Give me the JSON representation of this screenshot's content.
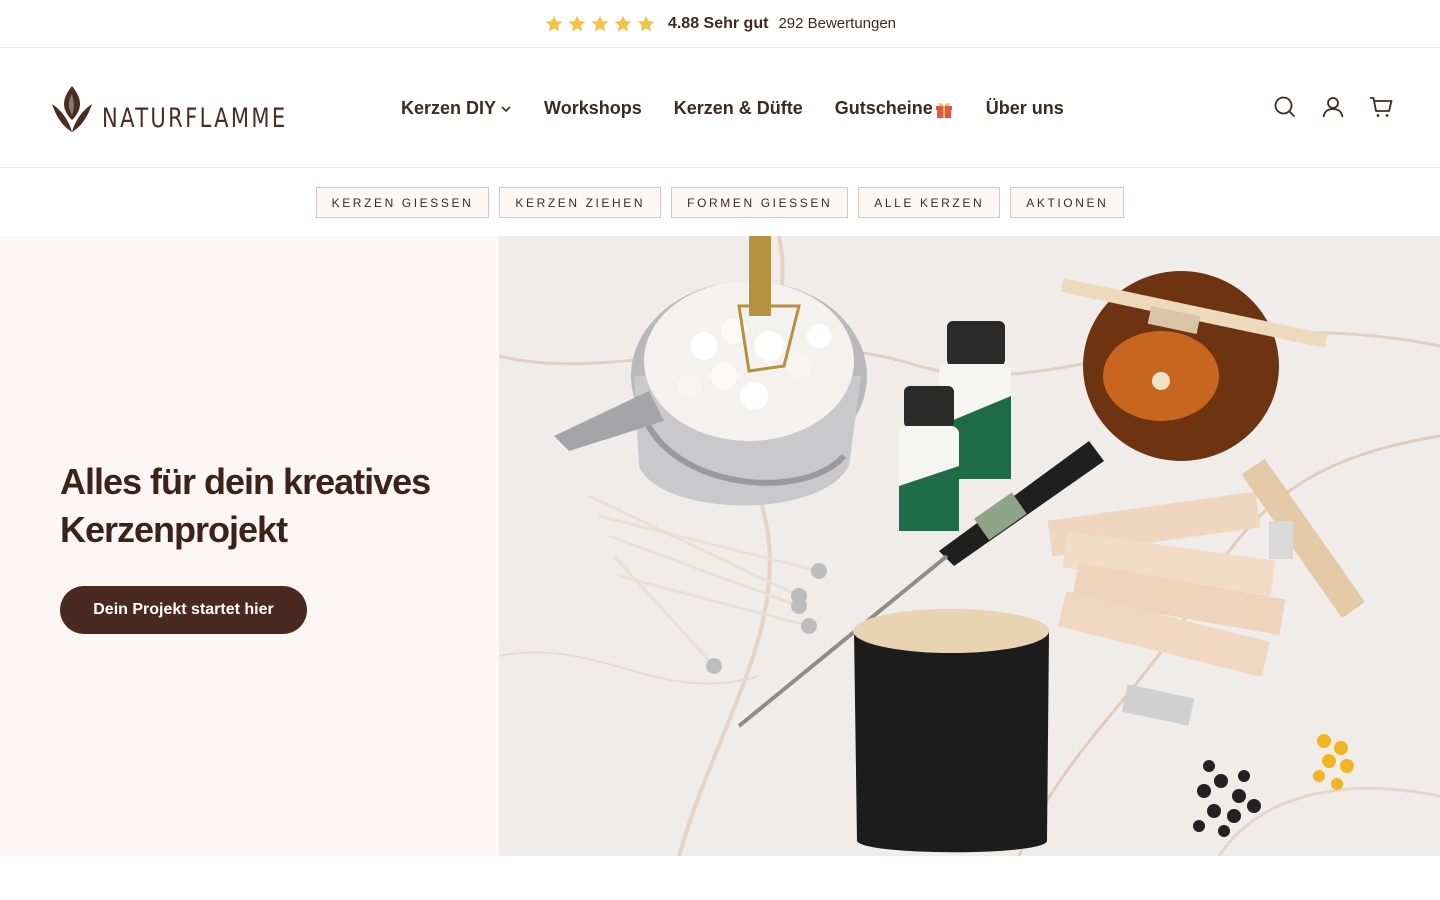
{
  "rating": {
    "stars": 5,
    "score_label": "4.88 Sehr gut",
    "count_label": "292 Bewertungen",
    "star_color": "#f5c343"
  },
  "header": {
    "logo_text": "NATURFLAMME",
    "nav": [
      {
        "label": "Kerzen DIY",
        "has_dropdown": true
      },
      {
        "label": "Workshops"
      },
      {
        "label": "Kerzen & Düfte"
      },
      {
        "label": "Gutscheine",
        "icon": "gift-icon"
      },
      {
        "label": "Über uns"
      }
    ],
    "icons": [
      "search-icon",
      "account-icon",
      "cart-icon"
    ]
  },
  "categories": [
    "KERZEN GIESSEN",
    "KERZEN ZIEHEN",
    "FORMEN GIESSEN",
    "ALLE KERZEN",
    "AKTIONEN"
  ],
  "hero": {
    "title": "Alles für dein kreatives Kerzenprojekt",
    "cta": "Dein Projekt startet hier",
    "image": "candle-making-supplies-photo"
  },
  "colors": {
    "brand_brown": "#4a2a20",
    "hero_bg": "#fcf6f4",
    "pill_border": "#d8c7c0"
  }
}
